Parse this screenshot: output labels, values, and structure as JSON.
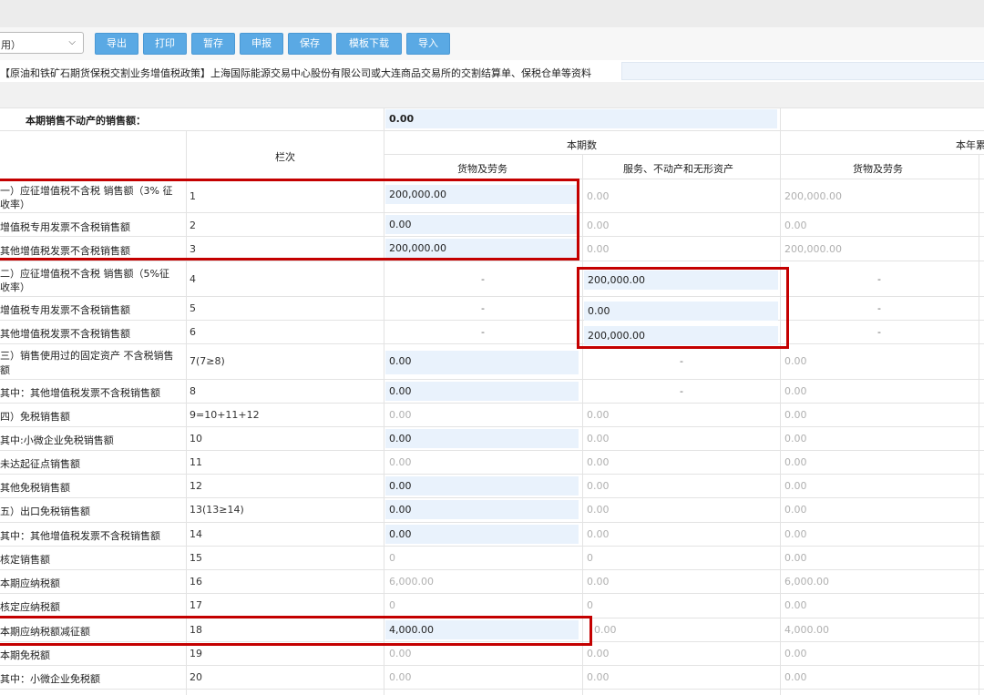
{
  "toolbar": {
    "select_value": "用）",
    "buttons": [
      "导出",
      "打印",
      "暂存",
      "申报",
      "保存",
      "模板下载",
      "导入"
    ]
  },
  "banner_text": "【原油和铁矿石期货保税交割业务增值税政策】上海国际能源交易中心股份有限公司或大连商品交易所的交割结算单、保税仓单等资料",
  "real_estate_row": {
    "label": "本期销售不动产的销售额：",
    "value": "0.00"
  },
  "header": {
    "line_col": "栏次",
    "current": "本期数",
    "ytd": "本年累",
    "goods": "货物及劳务",
    "services": "服务、不动产和无形资产",
    "goods2": "货物及劳务"
  },
  "rows": [
    {
      "label": "一）应征增值税不含税 销售额（3% 征",
      "label2": "收率）",
      "line": "1",
      "c1": "200,000.00",
      "c2": "0.00",
      "c3": "200,000.00"
    },
    {
      "label": "增值税专用发票不含税销售额",
      "line": "2",
      "c1": "0.00",
      "c2": "0.00",
      "c3": "0.00"
    },
    {
      "label": "其他增值税发票不含税销售额",
      "line": "3",
      "c1": "200,000.00",
      "c2": "0.00",
      "c3": "200,000.00"
    },
    {
      "label": "二）应征增值税不含税 销售额（5%征",
      "label2": "收率）",
      "line": "4",
      "c1": "-",
      "c2": "200,000.00",
      "c3": "-"
    },
    {
      "label": "增值税专用发票不含税销售额",
      "line": "5",
      "c1": "-",
      "c2": "0.00",
      "c3": "-"
    },
    {
      "label": "其他增值税发票不含税销售额",
      "line": "6",
      "c1": "-",
      "c2": "200,000.00",
      "c3": "-"
    },
    {
      "label": "三）销售使用过的固定资产 不含税销售",
      "label2": "额",
      "line": "7(7≥8)",
      "c1": "0.00",
      "c2": "-",
      "c3": "0.00"
    },
    {
      "label": "其中：其他增值税发票不含税销售额",
      "line": "8",
      "c1": "0.00",
      "c2": "-",
      "c3": "0.00"
    },
    {
      "label": "四）免税销售额",
      "line": "9=10+11+12",
      "c1": "0.00",
      "c2": "0.00",
      "c3": "0.00"
    },
    {
      "label": "其中:小微企业免税销售额",
      "line": "10",
      "c1": "0.00",
      "c2": "0.00",
      "c3": "0.00"
    },
    {
      "label": "未达起征点销售额",
      "line": "11",
      "c1": "0.00",
      "c2": "0.00",
      "c3": "0.00"
    },
    {
      "label": "其他免税销售额",
      "line": "12",
      "c1": "0.00",
      "c2": "0.00",
      "c3": "0.00"
    },
    {
      "label": "五）出口免税销售额",
      "line": "13(13≥14)",
      "c1": "0.00",
      "c2": "0.00",
      "c3": "0.00"
    },
    {
      "label": "其中：其他增值税发票不含税销售额",
      "line": "14",
      "c1": "0.00",
      "c2": "0.00",
      "c3": "0.00"
    },
    {
      "label": "核定销售额",
      "line": "15",
      "c1": "0",
      "c2": "0",
      "c3": "0.00"
    },
    {
      "label": "本期应纳税额",
      "line": "16",
      "c1": "6,000.00",
      "c2": "0.00",
      "c3": "6,000.00"
    },
    {
      "label": "核定应纳税额",
      "line": "17",
      "c1": "0",
      "c2": "0",
      "c3": "0.00"
    },
    {
      "label": "本期应纳税额减征额",
      "line": "18",
      "c1": "4,000.00",
      "c2": "0.00",
      "c3": "4,000.00"
    },
    {
      "label": "本期免税额",
      "line": "19",
      "c1": "0.00",
      "c2": "0.00",
      "c3": "0.00"
    },
    {
      "label": "其中：小微企业免税额",
      "line": "20",
      "c1": "0.00",
      "c2": "0.00",
      "c3": "0.00"
    }
  ]
}
